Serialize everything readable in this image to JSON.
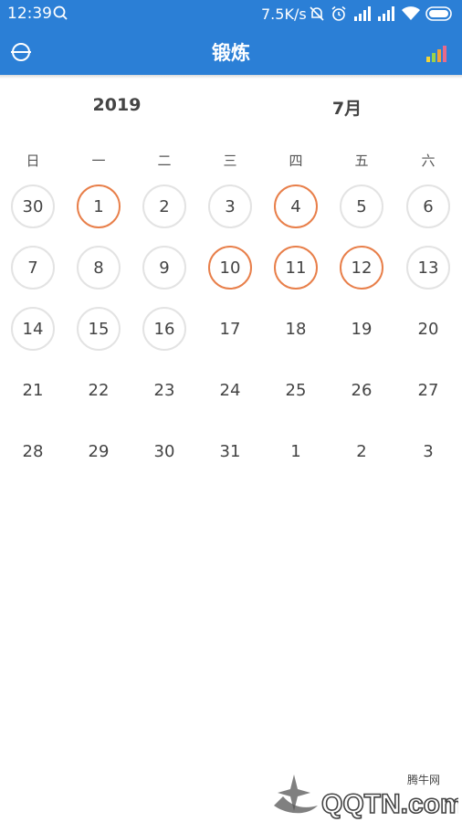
{
  "status_bar": {
    "time": "12:39",
    "speed": "7.5K/s",
    "icons": [
      "search-icon",
      "mute-bell-icon",
      "alarm-icon",
      "signal-icon",
      "signal-icon",
      "wifi-icon",
      "battery-icon"
    ]
  },
  "app_bar": {
    "title": "锻炼",
    "left_icon": "circle-toggle-icon",
    "right_icon": "bar-chart-icon"
  },
  "calendar": {
    "year": "2019",
    "month": "7月",
    "weekdays": [
      "日",
      "一",
      "二",
      "三",
      "四",
      "五",
      "六"
    ],
    "weeks": [
      [
        {
          "d": "30",
          "s": "ring"
        },
        {
          "d": "1",
          "s": "done"
        },
        {
          "d": "2",
          "s": "ring"
        },
        {
          "d": "3",
          "s": "ring"
        },
        {
          "d": "4",
          "s": "done"
        },
        {
          "d": "5",
          "s": "ring"
        },
        {
          "d": "6",
          "s": "ring"
        }
      ],
      [
        {
          "d": "7",
          "s": "ring"
        },
        {
          "d": "8",
          "s": "ring"
        },
        {
          "d": "9",
          "s": "ring"
        },
        {
          "d": "10",
          "s": "done"
        },
        {
          "d": "11",
          "s": "done"
        },
        {
          "d": "12",
          "s": "done"
        },
        {
          "d": "13",
          "s": "ring"
        }
      ],
      [
        {
          "d": "14",
          "s": "ring"
        },
        {
          "d": "15",
          "s": "ring"
        },
        {
          "d": "16",
          "s": "ring"
        },
        {
          "d": "17",
          "s": "none"
        },
        {
          "d": "18",
          "s": "none"
        },
        {
          "d": "19",
          "s": "none"
        },
        {
          "d": "20",
          "s": "none"
        }
      ],
      [
        {
          "d": "21",
          "s": "none"
        },
        {
          "d": "22",
          "s": "none"
        },
        {
          "d": "23",
          "s": "none"
        },
        {
          "d": "24",
          "s": "none"
        },
        {
          "d": "25",
          "s": "none"
        },
        {
          "d": "26",
          "s": "none"
        },
        {
          "d": "27",
          "s": "none"
        }
      ],
      [
        {
          "d": "28",
          "s": "none"
        },
        {
          "d": "29",
          "s": "none"
        },
        {
          "d": "30",
          "s": "none"
        },
        {
          "d": "31",
          "s": "none"
        },
        {
          "d": "1",
          "s": "none"
        },
        {
          "d": "2",
          "s": "none"
        },
        {
          "d": "3",
          "s": "none"
        }
      ]
    ]
  },
  "watermark": {
    "line1": "腾牛网",
    "line2": "QQTN.com"
  },
  "colors": {
    "app_bar": "#2b7fd6",
    "ring": "#e3e3e3",
    "done": "#e87f4a"
  }
}
